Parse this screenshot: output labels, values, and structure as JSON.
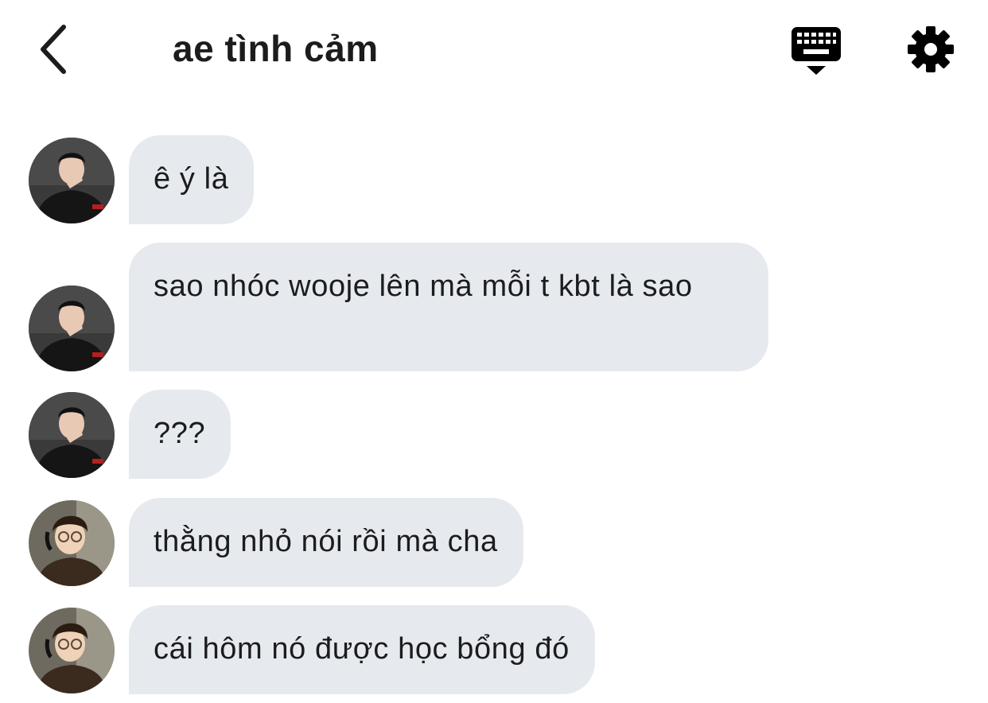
{
  "header": {
    "title": "ae tình cảm",
    "back_icon": "chevron-left-icon",
    "keyboard_icon": "keyboard-icon",
    "settings_icon": "gear-icon"
  },
  "colors": {
    "bubble_bg": "#e6eaef",
    "text": "#1c1c1e",
    "background": "#ffffff"
  },
  "messages": [
    {
      "sender": "user-a",
      "text": "ê ý là"
    },
    {
      "sender": "user-a",
      "text": "sao nhóc wooje lên mà mỗi t kbt là sao"
    },
    {
      "sender": "user-a",
      "text": "???"
    },
    {
      "sender": "user-b",
      "text": "thằng nhỏ nói rồi mà cha"
    },
    {
      "sender": "user-b",
      "text": "cái hôm nó được học bổng đó"
    }
  ]
}
